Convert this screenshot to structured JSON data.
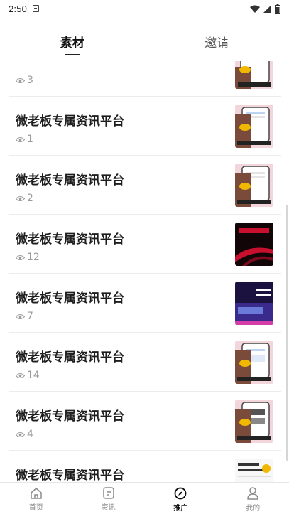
{
  "status_bar": {
    "time": "2:50"
  },
  "tabs": [
    {
      "label": "素材",
      "active": true
    },
    {
      "label": "邀请",
      "active": false
    }
  ],
  "items": [
    {
      "title": "",
      "views": "3",
      "thumb": "phone-pink"
    },
    {
      "title": "微老板专属资讯平台",
      "views": "1",
      "thumb": "phone-pink"
    },
    {
      "title": "微老板专属资讯平台",
      "views": "2",
      "thumb": "phone-pink"
    },
    {
      "title": "微老板专属资讯平台",
      "views": "12",
      "thumb": "red-poster"
    },
    {
      "title": "微老板专属资讯平台",
      "views": "7",
      "thumb": "purple-poster"
    },
    {
      "title": "微老板专属资讯平台",
      "views": "14",
      "thumb": "phone-pink"
    },
    {
      "title": "微老板专属资讯平台",
      "views": "4",
      "thumb": "phone-pink"
    },
    {
      "title": "微老板专属资讯平台",
      "views": "",
      "thumb": "white-poster"
    }
  ],
  "bottom_nav": [
    {
      "label": "首页",
      "icon": "home-icon",
      "active": false
    },
    {
      "label": "资讯",
      "icon": "news-icon",
      "active": false
    },
    {
      "label": "推广",
      "icon": "compass-icon",
      "active": true
    },
    {
      "label": "我的",
      "icon": "profile-icon",
      "active": false
    }
  ],
  "colors": {
    "text": "#1e1e1e",
    "muted": "#9a9a9a",
    "divider": "#ececec",
    "thumb_pink": "#f3d6dc",
    "thumb_red": "#c8102e",
    "thumb_purple": "#3a2a8c"
  }
}
